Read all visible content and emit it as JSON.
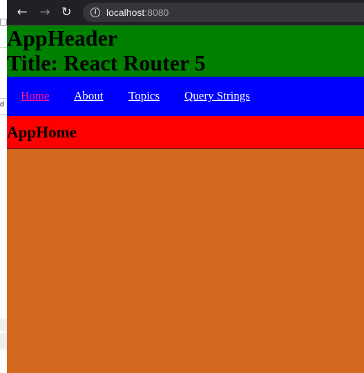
{
  "browser": {
    "back_icon": "arrow-left-icon",
    "forward_icon": "arrow-right-icon",
    "reload_icon": "reload-icon",
    "info_icon": "info-icon",
    "url_host": "localhost",
    "url_port": ":8080"
  },
  "behind_window": {
    "glyph": "d"
  },
  "header": {
    "app_title": "AppHeader",
    "page_title": "Title: React Router 5"
  },
  "nav": {
    "items": [
      {
        "label": "Home",
        "active": true
      },
      {
        "label": "About",
        "active": false
      },
      {
        "label": "Topics",
        "active": false
      },
      {
        "label": "Query Strings",
        "active": false
      }
    ]
  },
  "main": {
    "heading": "AppHome"
  },
  "colors": {
    "header_bg": "#008000",
    "nav_bg": "#0000ff",
    "nav_link": "#ffffff",
    "nav_active": "#ff1493",
    "section_bg": "#ff0000",
    "page_bg": "#d2691e"
  }
}
